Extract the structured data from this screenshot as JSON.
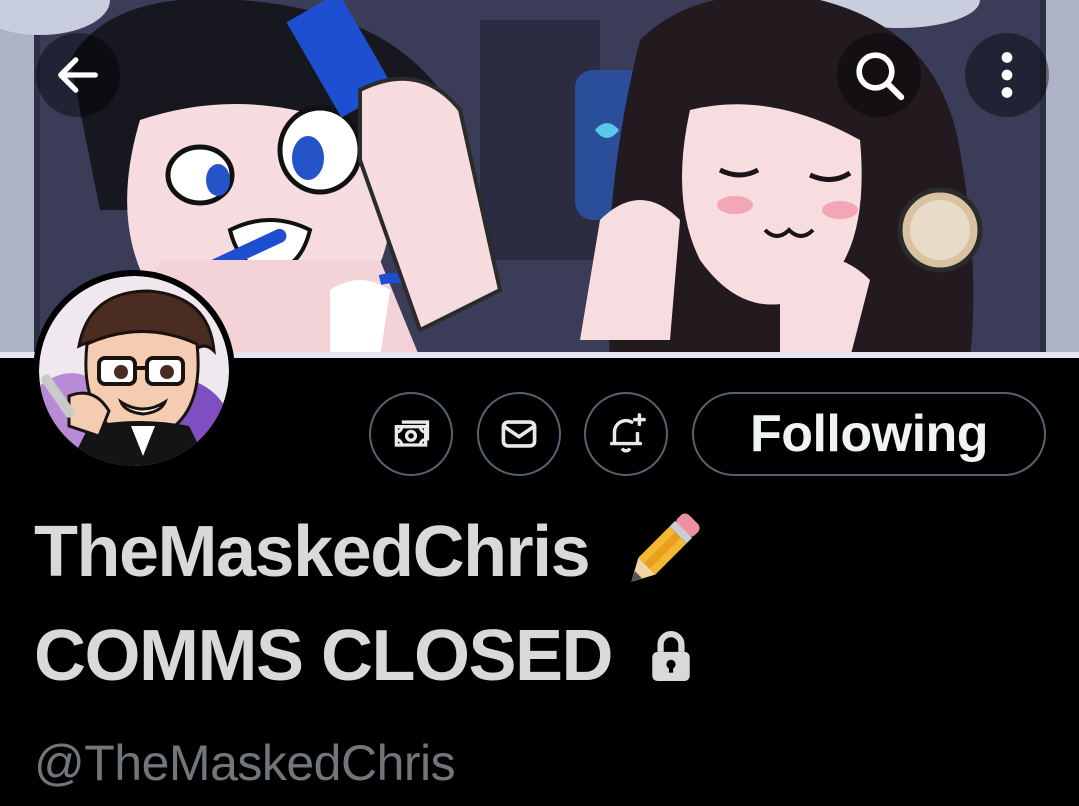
{
  "header": {
    "back_icon": "arrow-left-icon",
    "search_icon": "search-icon",
    "more_icon": "more-vertical-icon"
  },
  "banner": {
    "description_colors": {
      "frame": "#8f96ad",
      "skin": "#f6dcdf",
      "hair_dark": "#1a1418",
      "accent_blue": "#1d4fd0"
    }
  },
  "profile": {
    "avatar_icon": "avatar",
    "display_name_line1": "TheMaskedChris",
    "display_name_emoji": "pencil-emoji",
    "display_name_line2": "COMMS CLOSED",
    "protected_icon": "lock-icon",
    "handle": "@TheMaskedChris"
  },
  "actions": {
    "tip_icon": "money-icon",
    "message_icon": "envelope-icon",
    "notify_icon": "bell-plus-icon",
    "follow_label": "Following"
  },
  "colors": {
    "background": "#000000",
    "text_primary": "#d9d9d9",
    "text_secondary": "#71767b",
    "border": "#536471"
  }
}
